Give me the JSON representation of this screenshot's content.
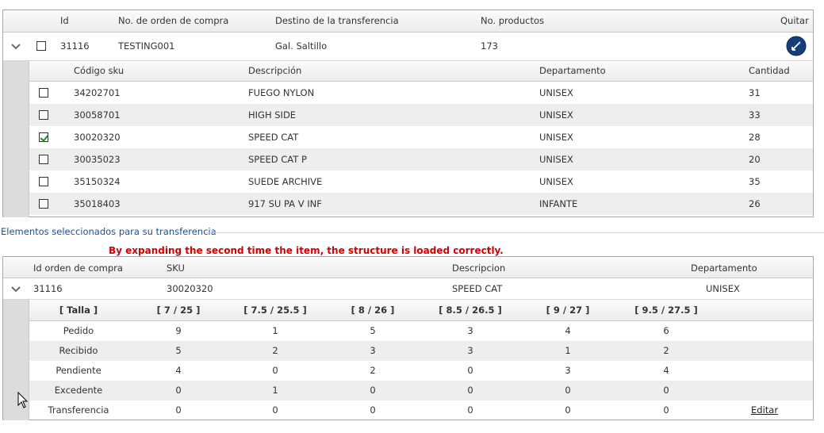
{
  "transfer_grid": {
    "headers": {
      "id": "Id",
      "order": "No. de orden de compra",
      "dest": "Destino de la transferencia",
      "products": "No. productos",
      "remove": "Quitar"
    },
    "row": {
      "id": "31116",
      "order": "TESTING001",
      "dest": "Gal. Saltillo",
      "products": "173"
    },
    "detail_headers": {
      "sku": "Código sku",
      "desc": "Descripción",
      "dept": "Departamento",
      "qty": "Cantidad"
    },
    "details": [
      {
        "sku": "34202701",
        "desc": "FUEGO NYLON",
        "dept": "UNISEX",
        "qty": "31",
        "checked": false
      },
      {
        "sku": "30058701",
        "desc": "HIGH SIDE",
        "dept": "UNISEX",
        "qty": "33",
        "checked": false
      },
      {
        "sku": "30020320",
        "desc": "SPEED CAT",
        "dept": "UNISEX",
        "qty": "28",
        "checked": true
      },
      {
        "sku": "30035023",
        "desc": "SPEED CAT P",
        "dept": "UNISEX",
        "qty": "20",
        "checked": false
      },
      {
        "sku": "35150324",
        "desc": "SUEDE ARCHIVE",
        "dept": "UNISEX",
        "qty": "35",
        "checked": false
      },
      {
        "sku": "35018403",
        "desc": "917 SU PA V INF",
        "dept": "INFANTE",
        "qty": "26",
        "checked": false
      }
    ]
  },
  "selected_label": "Elementos seleccionados para su transferencia",
  "annotation": "By expanding the second time the item, the structure is loaded correctly.",
  "selected_grid": {
    "headers": {
      "order": "Id orden de compra",
      "sku": "SKU",
      "desc": "Descripcion",
      "dept": "Departamento"
    },
    "row": {
      "order": "31116",
      "sku": "30020320",
      "desc": "SPEED CAT",
      "dept": "UNISEX"
    },
    "size_headers": [
      "[ Talla ]",
      "[ 7 / 25 ]",
      "[ 7.5 / 25.5 ]",
      "[ 8 / 26 ]",
      "[ 8.5 / 26.5 ]",
      "[ 9 / 27 ]",
      "[ 9.5 / 27.5 ]"
    ],
    "size_rows": [
      {
        "label": "Pedido",
        "values": [
          "9",
          "1",
          "5",
          "3",
          "4",
          "6"
        ]
      },
      {
        "label": "Recibido",
        "values": [
          "5",
          "2",
          "3",
          "3",
          "1",
          "2"
        ]
      },
      {
        "label": "Pendiente",
        "values": [
          "4",
          "0",
          "2",
          "0",
          "3",
          "4"
        ]
      },
      {
        "label": "Excedente",
        "values": [
          "0",
          "1",
          "0",
          "0",
          "0",
          "0"
        ]
      },
      {
        "label": "Transferencia",
        "values": [
          "0",
          "0",
          "0",
          "0",
          "0",
          "0"
        ]
      }
    ],
    "edit_label": "Editar"
  }
}
